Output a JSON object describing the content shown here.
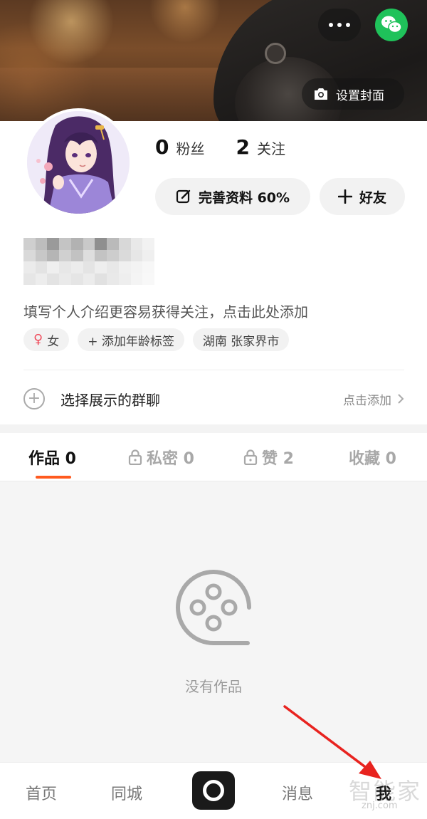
{
  "cover": {
    "set_cover_label": "设置封面"
  },
  "stats": {
    "fans_count": "0",
    "fans_label": "粉丝",
    "following_count": "2",
    "following_label": "关注"
  },
  "actions": {
    "edit_profile_label": "完善资料 60%",
    "add_friend_label": "好友"
  },
  "profile": {
    "bio_placeholder": "填写个人介绍更容易获得关注，点击此处添加",
    "tags": {
      "gender": "女",
      "age": "+ 添加年龄标签",
      "location": "湖南 张家界市"
    },
    "group_label": "选择展示的群聊",
    "group_action": "点击添加"
  },
  "tabs": {
    "works": "作品 0",
    "private": "私密 0",
    "likes": "赞 2",
    "favorites": "收藏 0"
  },
  "empty_state": {
    "text": "没有作品"
  },
  "bottom_nav": {
    "home": "首页",
    "nearby": "同城",
    "messages": "消息",
    "me": "我"
  },
  "watermark": {
    "text": "智能家",
    "sub": "znj.com"
  },
  "colors": {
    "accent": "#ff5a1f",
    "wechat": "#1fc25a",
    "arrow": "#e8231f"
  }
}
